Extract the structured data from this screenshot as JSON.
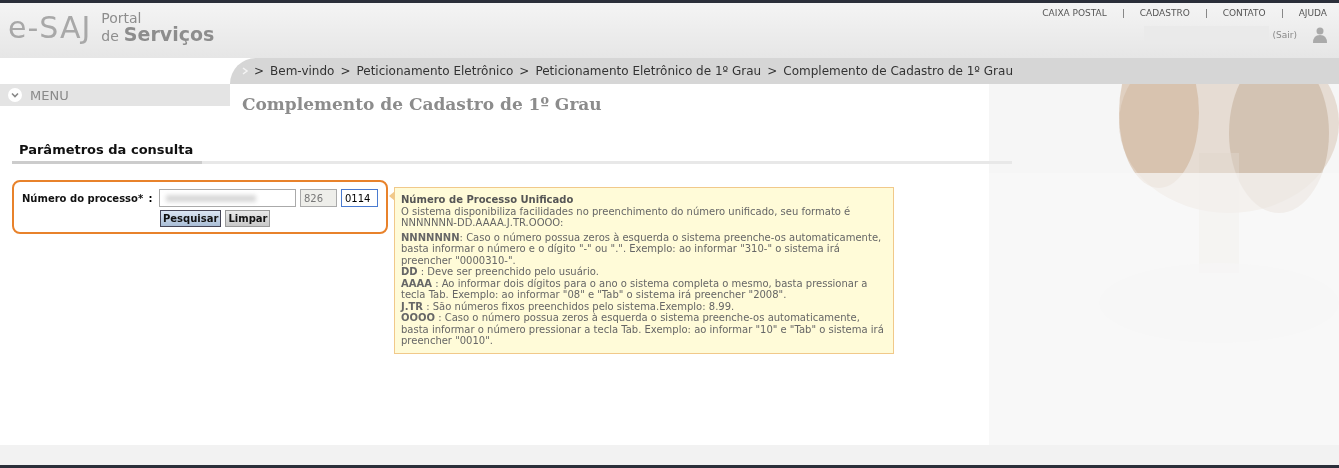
{
  "logo": {
    "mark": "e-SAJ",
    "line_1": "Portal",
    "line_2_small": "de",
    "line_2": "Serviços"
  },
  "top_nav": [
    "CAIXA POSTAL",
    "CADASTRO",
    "CONTATO",
    "AJUDA"
  ],
  "user": {
    "logout": "(Sair)"
  },
  "breadcrumb": {
    "separator": ">",
    "items": [
      "Bem-vindo",
      "Peticionamento Eletrônico",
      "Peticionamento Eletrônico de 1º Grau",
      "Complemento de Cadastro de 1º Grau"
    ]
  },
  "menu": {
    "label": "MENU",
    "expanded": false
  },
  "page_title": "Complemento de Cadastro de 1º Grau",
  "section_title": "Parâmetros da consulta",
  "form": {
    "label": "Número do processo*",
    "separator": ":",
    "fields": [
      {
        "kind": "redacted"
      },
      {
        "kind": "readonly",
        "value": "826"
      },
      {
        "kind": "focused",
        "value": "0114"
      }
    ],
    "buttons": [
      {
        "label": "Pesquisar",
        "primary": true
      },
      {
        "label": "Limpar",
        "primary": false
      }
    ]
  },
  "tooltip": {
    "title": "Número de Processo Unificado",
    "intro": "O sistema disponibiliza facilidades no preenchimento do número unificado, seu formato é NNNNNNN-DD.AAAA.J.TR.OOOO:",
    "items": [
      "**NNNNNNN**: Caso o número possua zeros à esquerda o sistema preenche-os automaticamente, basta informar o número e o dígito \"-\" ou \".\". Exemplo: ao informar \"310-\" o sistema irá preencher \"0000310-\".",
      "**DD** : Deve ser preenchido pelo usuário.",
      "**AAAA** : Ao informar dois dígitos para o ano o sistema completa o mesmo, basta pressionar a tecla Tab. Exemplo: ao informar \"08\" e \"Tab\" o sistema irá preencher \"2008\".",
      "**J.TR** : São números fixos preenchidos pelo sistema.Exemplo: 8.99.",
      "**OOOO** : Caso o número possua zeros à esquerda o sistema preenche-os automaticamente, basta informar o número pressionar a tecla Tab. Exemplo: ao informar \"10\" e \"Tab\" o sistema irá preencher \"0010\"."
    ]
  }
}
